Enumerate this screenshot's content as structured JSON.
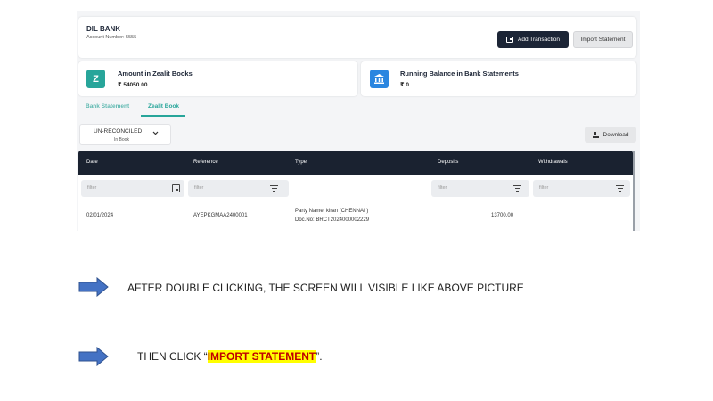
{
  "header": {
    "bank_name": "DIL BANK",
    "account_number": "Account Number: 5555",
    "add_transaction_label": "Add Transaction",
    "import_statement_label": "Import Statement"
  },
  "summary": {
    "left_title": "Amount in Zealit Books",
    "left_value": "₹ 54050.00",
    "left_icon_letter": "Z",
    "right_title": "Running Balance in Bank Statements",
    "right_value": "₹ 0"
  },
  "tabs": [
    {
      "label": "Bank Statement",
      "active": false
    },
    {
      "label": "Zealit Book",
      "active": true
    }
  ],
  "filter": {
    "main": "UN-RECONCILED",
    "sub": "In Book"
  },
  "download_label": "Download",
  "table": {
    "columns": [
      "Date",
      "Reference",
      "Type",
      "Deposits",
      "Withdrawals"
    ],
    "filter_placeholder": "filter",
    "rows": [
      {
        "date": "02/01/2024",
        "reference": "AYEPKGMAA2400001",
        "type_line1": "Party Name: kiran (CHENNAI )",
        "type_line2": "Doc.No: BRCT2024000002229",
        "deposits": "13700.00",
        "withdrawals": ""
      }
    ]
  },
  "instructions": [
    {
      "text": "AFTER DOUBLE CLICKING, THE SCREEN WILL VISIBLE LIKE ABOVE PICTURE"
    },
    {
      "prefix": "THEN CLICK “",
      "highlight": "IMPORT STATEMENT",
      "suffix": "”."
    }
  ],
  "colors": {
    "dark": "#1c2536",
    "teal": "#27a59a",
    "bank_blue": "#2a86e0",
    "annotation_red": "#e02020",
    "arrow_blue": "#4472c4",
    "highlight": "#ffff00"
  }
}
